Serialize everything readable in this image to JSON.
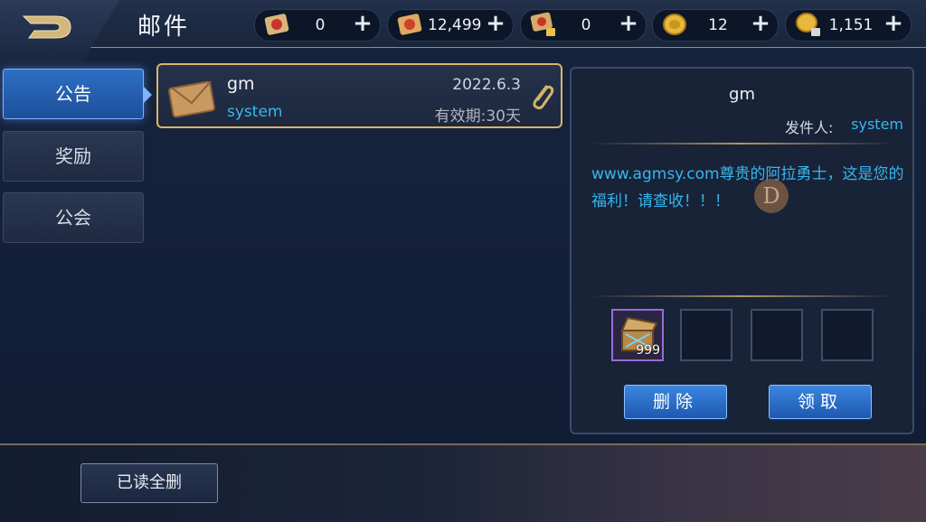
{
  "header": {
    "title": "邮件",
    "resources": [
      {
        "icon": "red-scroll-icon",
        "value": "0"
      },
      {
        "icon": "orange-scroll-icon",
        "value": "12,499"
      },
      {
        "icon": "locked-scroll-icon",
        "value": "0"
      },
      {
        "icon": "gold-coin-icon",
        "value": "12"
      },
      {
        "icon": "locked-gold-coin-icon",
        "value": "1,151"
      }
    ]
  },
  "tabs": [
    {
      "label": "公告",
      "active": true
    },
    {
      "label": "奖励",
      "active": false
    },
    {
      "label": "公会",
      "active": false
    }
  ],
  "mail_list": [
    {
      "sender": "gm",
      "from": "system",
      "date": "2022.6.3",
      "expiry": "有效期:30天"
    }
  ],
  "detail": {
    "title": "gm",
    "sender_label": "发件人:",
    "sender_value": "system",
    "body": "www.agmsy.com尊贵的阿拉勇士，这是您的福利！请查收！！！",
    "attachments": [
      {
        "icon": "treasure-chest-icon",
        "count": "999"
      }
    ],
    "delete_label": "删除",
    "claim_label": "领取"
  },
  "footer": {
    "delete_all_label": "已读全删"
  },
  "colors": {
    "accent_blue": "#37b6ee",
    "gold_border": "#d9b56a"
  }
}
